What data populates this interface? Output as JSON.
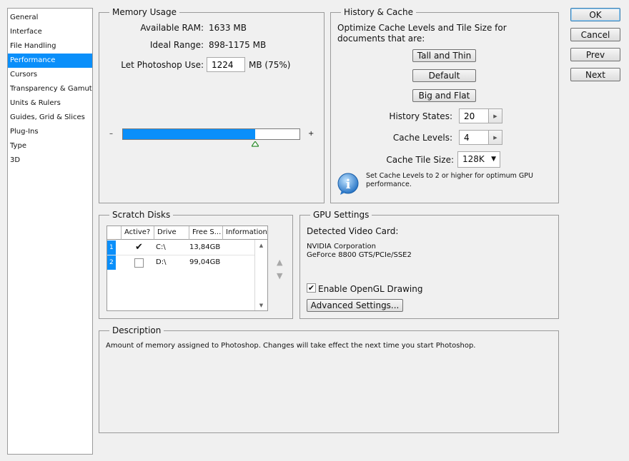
{
  "nav": {
    "items": [
      "General",
      "Interface",
      "File Handling",
      "Performance",
      "Cursors",
      "Transparency & Gamut",
      "Units & Rulers",
      "Guides, Grid & Slices",
      "Plug-Ins",
      "Type",
      "3D"
    ],
    "selected": 3
  },
  "memory": {
    "title": "Memory Usage",
    "available_label": "Available RAM:",
    "available_value": "1633 MB",
    "ideal_label": "Ideal Range:",
    "ideal_value": "898-1175 MB",
    "use_label": "Let Photoshop Use:",
    "use_value": "1224",
    "use_suffix": "MB (75%)",
    "minus": "–",
    "plus": "+",
    "slider_fraction": 0.75
  },
  "history": {
    "title": "History & Cache",
    "intro": "Optimize Cache Levels and Tile Size for documents that are:",
    "tall_thin": "Tall and Thin",
    "default_btn": "Default",
    "big_flat": "Big and Flat",
    "states_label": "History States:",
    "states_value": "20",
    "levels_label": "Cache Levels:",
    "levels_value": "4",
    "tile_label": "Cache Tile Size:",
    "tile_value": "128K",
    "tip": "Set Cache Levels to 2 or higher for optimum GPU performance."
  },
  "scratch": {
    "title": "Scratch Disks",
    "columns": [
      "Active?",
      "Drive",
      "Free S...",
      "Information"
    ],
    "rows": [
      {
        "num": "1",
        "active": "✔",
        "drive": "C:\\",
        "free": "13,84GB",
        "info": ""
      },
      {
        "num": "2",
        "active": "",
        "drive": "D:\\",
        "free": "99,04GB",
        "info": ""
      }
    ],
    "up": "▲",
    "down": "▼"
  },
  "gpu": {
    "title": "GPU Settings",
    "detected_label": "Detected Video Card:",
    "vendor": "NVIDIA Corporation",
    "card": "GeForce 8800 GTS/PCIe/SSE2",
    "opengl_label": "Enable OpenGL Drawing",
    "opengl_check": "✔",
    "advanced": "Advanced Settings..."
  },
  "description": {
    "title": "Description",
    "text": "Amount of memory assigned to Photoshop. Changes will take effect the next time you start Photoshop."
  },
  "buttons": {
    "ok": "OK",
    "cancel": "Cancel",
    "prev": "Prev",
    "next": "Next"
  },
  "colors": {
    "accent": "#0a8ffa"
  },
  "icons": {
    "info": "i"
  }
}
